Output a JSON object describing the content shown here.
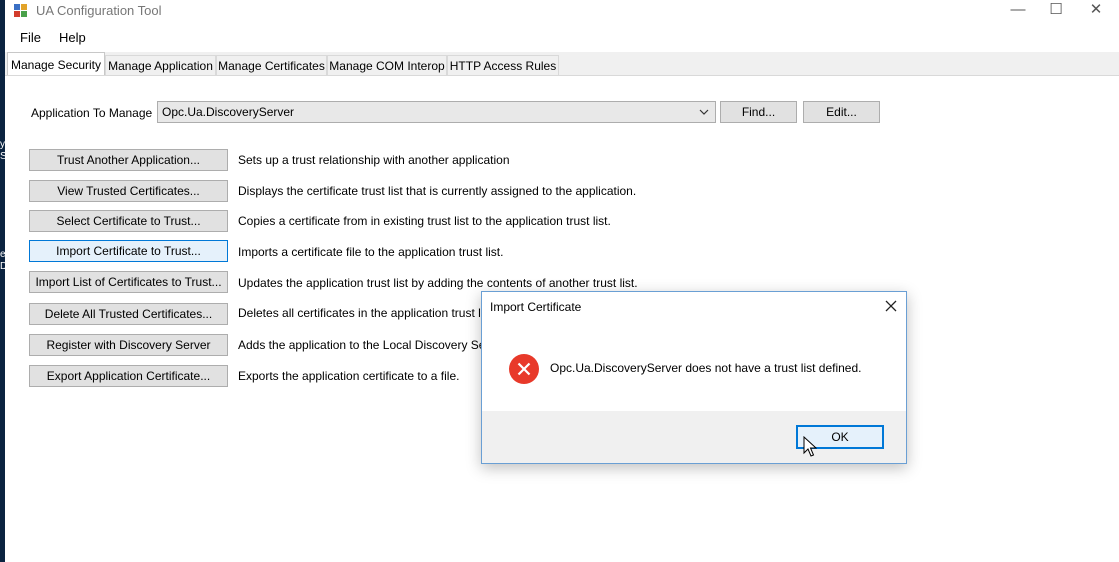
{
  "window": {
    "title": "UA Configuration Tool",
    "controls": {
      "minimize": "—",
      "maximize": "☐",
      "close": "✕"
    }
  },
  "menu": [
    "File",
    "Help"
  ],
  "tabs": [
    "Manage Security",
    "Manage Application",
    "Manage Certificates",
    "Manage COM Interop",
    "HTTP Access Rules"
  ],
  "active_tab_index": 0,
  "manage": {
    "label": "Application To Manage",
    "selected": "Opc.Ua.DiscoveryServer",
    "find_label": "Find...",
    "edit_label": "Edit..."
  },
  "actions": [
    {
      "button": "Trust Another Application...",
      "description": "Sets up a trust relationship with another application"
    },
    {
      "button": "View Trusted Certificates...",
      "description": "Displays the certificate trust list that is currently assigned to the application."
    },
    {
      "button": "Select Certificate to Trust...",
      "description": "Copies a certificate from in existing trust list to the application trust list."
    },
    {
      "button": "Import Certificate to Trust...",
      "description": "Imports a certificate file to the application trust list."
    },
    {
      "button": "Import List of Certificates to Trust...",
      "description": "Updates the application trust list by adding the contents of another trust list."
    },
    {
      "button": "Delete All Trusted Certificates...",
      "description": "Deletes all certificates in the application trust list."
    },
    {
      "button": "Register with Discovery Server",
      "description": "Adds the application to the Local Discovery Serve"
    },
    {
      "button": "Export Application Certificate...",
      "description": "Exports the application certificate to a file."
    }
  ],
  "focused_action_index": 3,
  "dialog": {
    "title": "Import Certificate",
    "message": "Opc.Ua.DiscoveryServer does not have a trust list defined.",
    "ok_label": "OK",
    "icon": "error-icon"
  },
  "colors": {
    "error_red": "#e8392a",
    "focus_blue": "#0078d7",
    "desktop": "#0b2340"
  },
  "desktop_edge_chars": [
    "y",
    "S",
    "e",
    "D"
  ]
}
